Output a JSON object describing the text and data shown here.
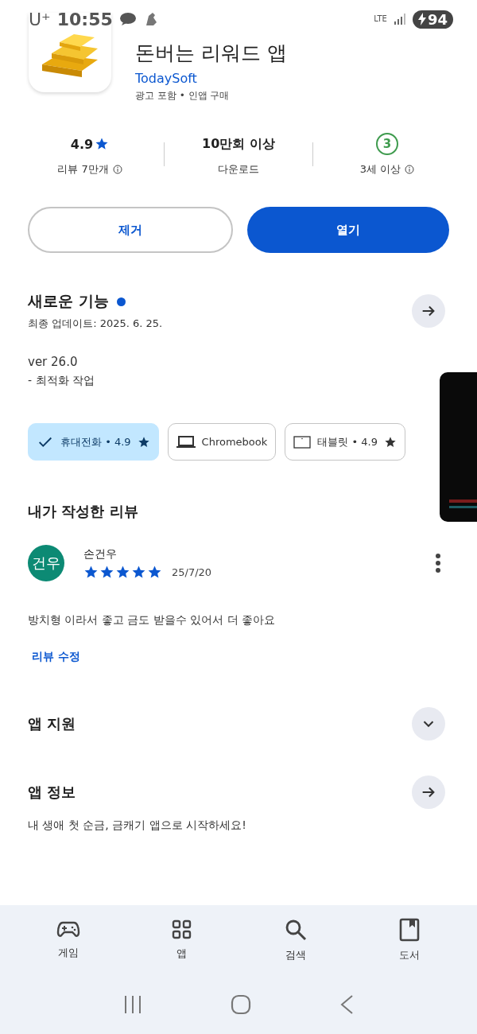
{
  "status_bar": {
    "carrier": "U⁺",
    "time": "10:55",
    "network": "LTE",
    "battery": "94"
  },
  "app": {
    "title_line": "돈버는 리워드 앱",
    "developer": "TodaySoft",
    "notes": "광고 포함 • 인앱 구매"
  },
  "stats": [
    {
      "kind": "rating",
      "value": "4.9",
      "label": "리뷰 7만개",
      "info": true
    },
    {
      "kind": "text",
      "value": "10만회 이상",
      "label": "다운로드",
      "info": false
    },
    {
      "kind": "age",
      "value": "3",
      "label": "3세 이상",
      "info": true
    }
  ],
  "buttons": [
    {
      "label": "제거",
      "primary": false
    },
    {
      "label": "열기",
      "primary": true
    }
  ],
  "whats_new": {
    "title": "새로운 기능",
    "new_dot": true,
    "updated": "최종 업데이트: 2025. 6. 25.",
    "version": "ver 26.0",
    "notes": "- 최적화 작업"
  },
  "devices": [
    {
      "label": "휴대전화 • 4.9",
      "star": true,
      "selected": true
    },
    {
      "kind": "laptop",
      "label": "Chromebook",
      "star": false,
      "selected": false
    },
    {
      "kind": "tablet",
      "label": "태블릿 • 4.9",
      "star": true,
      "selected": false
    }
  ],
  "my_review": {
    "title": "내가 작성한 리뷰",
    "avatar": "건우",
    "author": "손건우",
    "stars": 5,
    "date": "25/7/20",
    "text": "방치형 이라서 좋고 금도 받을수 있어서 더 좋아요",
    "edit": "리뷰 수정"
  },
  "sections": [
    {
      "kind": "expand",
      "title": "앱 지원"
    },
    {
      "kind": "arrow",
      "title": "앱 정보",
      "text": "내 생애 첫 순금, 금캐기 앱으로 시작하세요!"
    }
  ],
  "bottom_nav": [
    {
      "kind": "game",
      "label": "게임"
    },
    {
      "kind": "apps",
      "label": "앱"
    },
    {
      "kind": "search",
      "label": "검색"
    },
    {
      "kind": "book",
      "label": "도서"
    }
  ]
}
